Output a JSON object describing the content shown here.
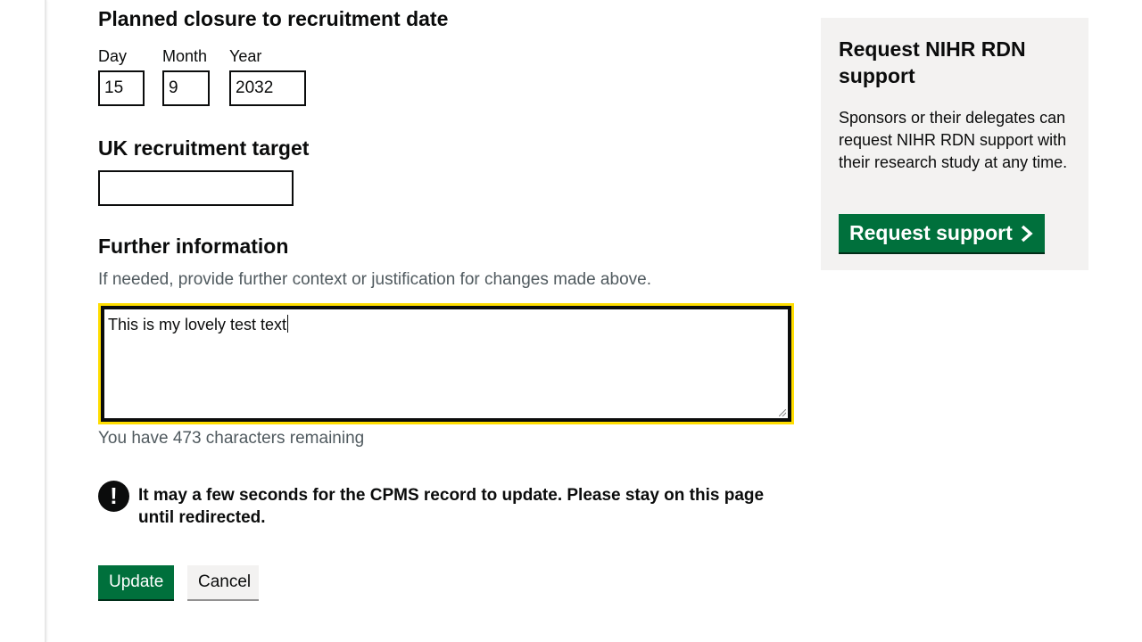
{
  "date_section": {
    "heading": "Planned closure to recruitment date",
    "day_label": "Day",
    "month_label": "Month",
    "year_label": "Year",
    "day_value": "15",
    "month_value": "9",
    "year_value": "2032"
  },
  "recruitment": {
    "heading": "UK recruitment target",
    "value": ""
  },
  "further_info": {
    "heading": "Further information",
    "hint": "If needed, provide further context or justification for changes made above.",
    "value": "This is my lovely test text",
    "char_count": "You have 473 characters remaining"
  },
  "warning": {
    "icon_glyph": "!",
    "text": "It may a few seconds for the CPMS record to update. Please stay on this page until redirected."
  },
  "actions": {
    "update_label": "Update",
    "cancel_label": "Cancel"
  },
  "sidebar": {
    "title": "Request NIHR RDN support",
    "body": "Sponsors or their delegates can request NIHR RDN support with their research study at any time.",
    "button_label": "Request support"
  },
  "colors": {
    "primary_green": "#00703c",
    "focus_yellow": "#ffdd00",
    "panel_grey": "#f3f2f1",
    "hint_grey": "#505a5f"
  }
}
